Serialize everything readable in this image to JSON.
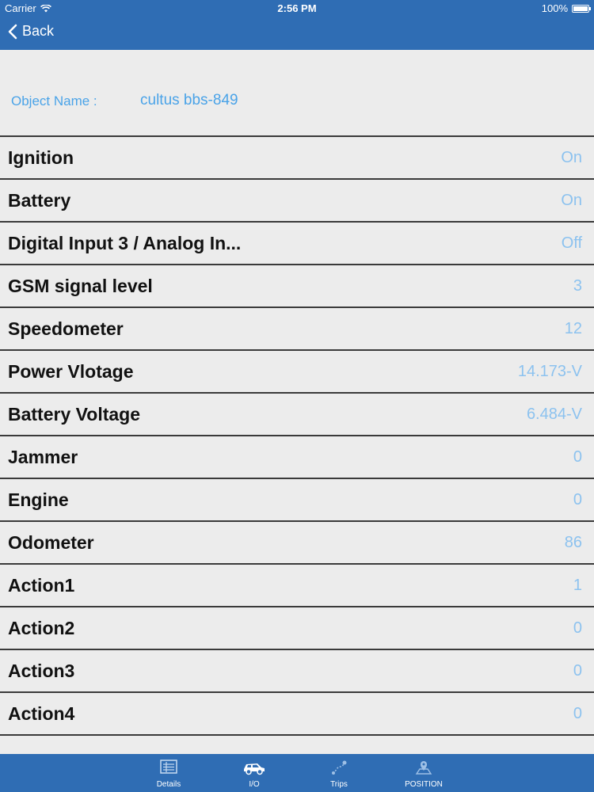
{
  "status_bar": {
    "carrier": "Carrier",
    "time": "2:56 PM",
    "battery": "100%"
  },
  "nav": {
    "back_label": "Back"
  },
  "object": {
    "label": "Object Name :",
    "value": "cultus bbs-849"
  },
  "rows": [
    {
      "name": "Ignition",
      "value": "On"
    },
    {
      "name": "Battery",
      "value": "On"
    },
    {
      "name": "Digital Input 3 / Analog In...",
      "value": "Off"
    },
    {
      "name": "GSM signal level",
      "value": "3"
    },
    {
      "name": "Speedometer",
      "value": "12"
    },
    {
      "name": "Power Vlotage",
      "value": "14.173-V"
    },
    {
      "name": "Battery Voltage",
      "value": "6.484-V"
    },
    {
      "name": "Jammer",
      "value": "0"
    },
    {
      "name": "Engine",
      "value": "0"
    },
    {
      "name": "Odometer",
      "value": "86"
    },
    {
      "name": "Action1",
      "value": "1"
    },
    {
      "name": "Action2",
      "value": "0"
    },
    {
      "name": "Action3",
      "value": "0"
    },
    {
      "name": "Action4",
      "value": "0"
    }
  ],
  "tabs": [
    {
      "label": "Details",
      "icon": "details-icon"
    },
    {
      "label": "I/O",
      "icon": "car-icon"
    },
    {
      "label": "Trips",
      "icon": "trips-icon"
    },
    {
      "label": "POSITION",
      "icon": "position-icon"
    }
  ],
  "colors": {
    "bar": "#2f6db4",
    "accent": "#4aa3e8",
    "value": "#8cc2ef",
    "background": "#ececec"
  }
}
